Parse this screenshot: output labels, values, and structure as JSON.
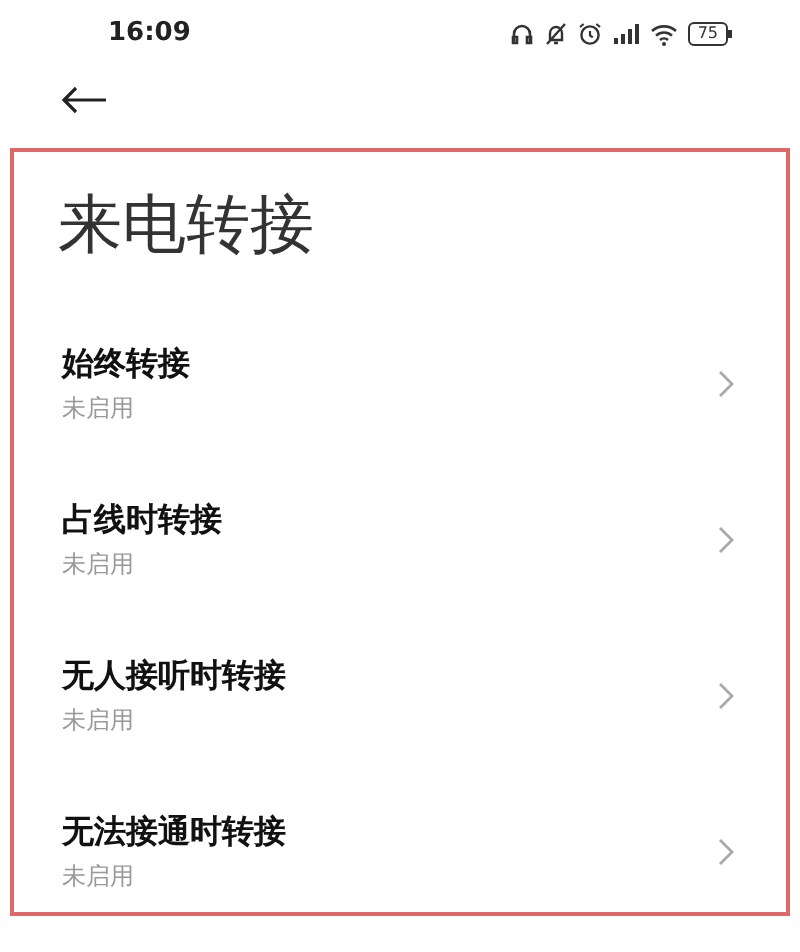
{
  "status_bar": {
    "time": "16:09",
    "battery": "75"
  },
  "title": "来电转接",
  "items": [
    {
      "label": "始终转接",
      "status": "未启用"
    },
    {
      "label": "占线时转接",
      "status": "未启用"
    },
    {
      "label": "无人接听时转接",
      "status": "未启用"
    },
    {
      "label": "无法接通时转接",
      "status": "未启用"
    }
  ]
}
